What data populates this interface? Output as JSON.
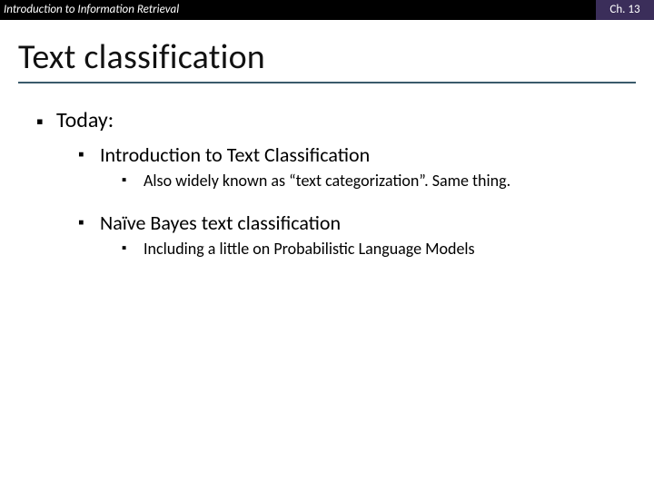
{
  "header": {
    "left": "Introduction to Information Retrieval",
    "right": "Ch. 13"
  },
  "title": "Text classification",
  "bullets": {
    "l1": "Today:",
    "l2a": "Introduction to Text Classification",
    "l3a": "Also widely known as “text categorization”. Same thing.",
    "l2b": "Naïve Bayes text classification",
    "l3b": "Including a little on Probabilistic Language Models"
  }
}
